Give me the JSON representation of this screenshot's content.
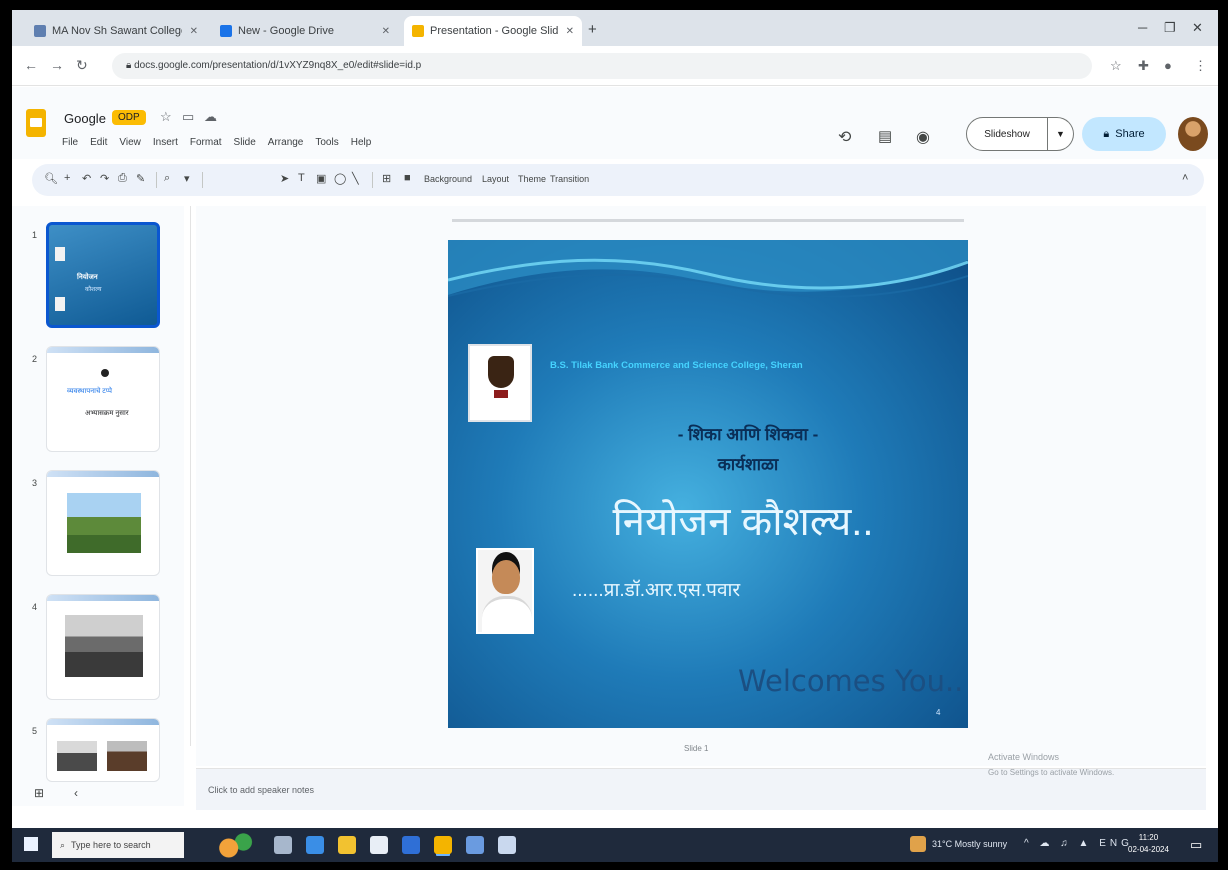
{
  "browser": {
    "tabs": [
      {
        "label": "MA Nov Sh Sawant College",
        "favicon_color": "#5f7fb0",
        "active": false
      },
      {
        "label": "New - Google Drive",
        "favicon_color": "#1a73e8",
        "active": false
      },
      {
        "label": "Presentation - Google Slides",
        "favicon_color": "#f4b400",
        "active": true
      }
    ],
    "new_tab": "+",
    "url": "docs.google.com/presentation/d/1vXYZ9nq8X_e0/edit#slide=id.p"
  },
  "app": {
    "doc_title": "Google",
    "ext_badge": "ODP",
    "menus": [
      "File",
      "Edit",
      "View",
      "Insert",
      "Format",
      "Slide",
      "Arrange",
      "Tools",
      "Help"
    ],
    "slideshow_label": "Slideshow",
    "share_label": "Share"
  },
  "toolbar": {
    "background": "Background",
    "layout": "Layout",
    "theme": "Theme",
    "transition": "Transition"
  },
  "filmstrip": {
    "slides": [
      {
        "num": "1",
        "title": "नियोजन",
        "sub": "कौशल्य"
      },
      {
        "num": "2",
        "line1": "व्यवस्थापनाचे टप्पे",
        "line2": "अभ्यासक्रम नुसार"
      },
      {
        "num": "3"
      },
      {
        "num": "4"
      },
      {
        "num": "5"
      }
    ]
  },
  "slide": {
    "college_name": "B.S. Tilak Bank Commerce and Science College, Sheran",
    "program_line1": "- शिका आणि शिकवा -",
    "program_line2": "कार्यशाळा",
    "main_title": "नियोजन कौशल्य..",
    "speaker": "......प्रा.डॉ.आर.एस.पवार",
    "welcome": "Welcomes You..",
    "corner": "4"
  },
  "canvas_caption": "Slide 1",
  "notes": {
    "placeholder": "Click to add speaker notes"
  },
  "watermark": {
    "line1": "Activate Windows",
    "line2": "Go to Settings to activate Windows."
  },
  "taskbar": {
    "search_placeholder": "Type here to search",
    "tray_status": "31°C Mostly sunny",
    "tray_icons": "^ ☁ ♫ ▲ ENG",
    "clock_time": "11:20",
    "clock_date": "02-04-2024"
  }
}
